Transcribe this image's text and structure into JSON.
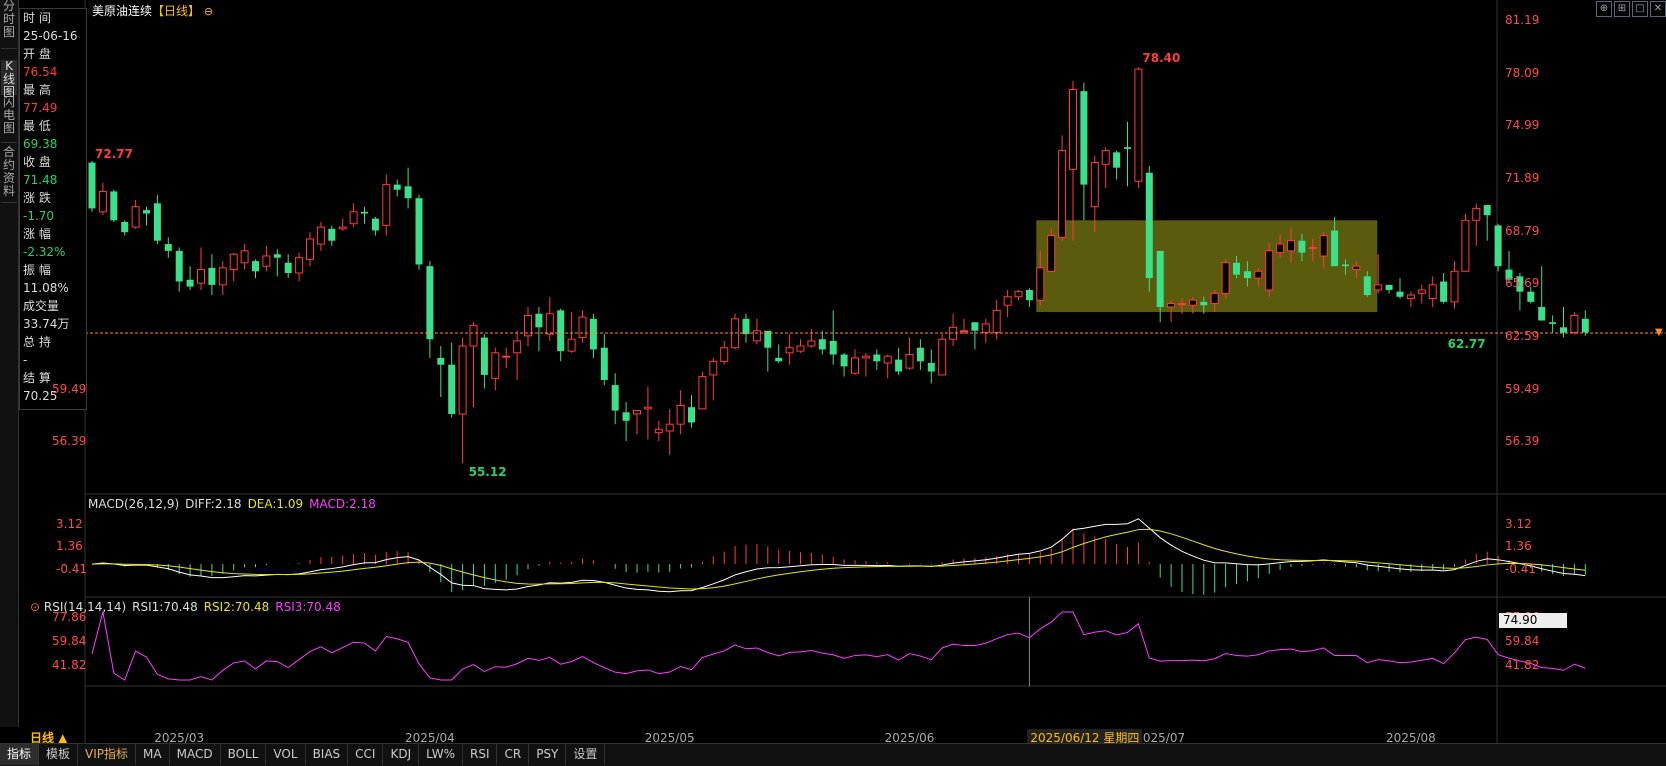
{
  "header": {
    "instrument": "美原油连续",
    "period": "【日线】",
    "settings_icon": "gear-icon"
  },
  "left_tabs": [
    {
      "label": "分时图",
      "active": false
    },
    {
      "label": "K线图",
      "active": true
    },
    {
      "label": "闪电图",
      "active": false
    },
    {
      "label": "合约资料",
      "active": false
    }
  ],
  "info": [
    {
      "label": "时 间",
      "value": "25-06-16",
      "color": "white"
    },
    {
      "label": "开 盘",
      "value": "76.54",
      "color": "red"
    },
    {
      "label": "最 高",
      "value": "77.49",
      "color": "red"
    },
    {
      "label": "最 低",
      "value": "69.38",
      "color": "green"
    },
    {
      "label": "收 盘",
      "value": "71.48",
      "color": "green"
    },
    {
      "label": "涨 跌",
      "value": "-1.70",
      "color": "green"
    },
    {
      "label": "涨 幅",
      "value": "-2.32%",
      "color": "green"
    },
    {
      "label": "振 幅",
      "value": "11.08%",
      "color": "white"
    },
    {
      "label": "成交量",
      "value": "33.74万",
      "color": "white"
    },
    {
      "label": "总 持",
      "value": "-",
      "color": "white"
    },
    {
      "label": "结 算",
      "value": "70.25",
      "color": "white"
    }
  ],
  "price_axis": {
    "labels": [
      "81.19",
      "78.09",
      "74.99",
      "71.89",
      "68.79",
      "65.69",
      "62.59",
      "59.49",
      "56.39"
    ],
    "min": 53.29,
    "max": 81.19,
    "current": "74.90"
  },
  "left_axis": [
    "59.49",
    "56.39"
  ],
  "annotations": {
    "high": "78.40",
    "low": "55.12",
    "start": "72.77",
    "last": "62.77"
  },
  "macd": {
    "title": "MACD(26,12,9)",
    "diff": "DIFF:2.18",
    "dea": "DEA:1.09",
    "macd": "MACD:2.18",
    "labels": [
      "3.12",
      "1.36",
      "-0.41"
    ]
  },
  "rsi": {
    "title": "RSI(14,14,14)",
    "rsi1": "RSI1:70.48",
    "rsi2": "RSI2:70.48",
    "rsi3": "RSI3:70.48",
    "labels": [
      "77.86",
      "59.84",
      "41.82"
    ]
  },
  "x_axis": {
    "labels": [
      "2025/03",
      "2025/04",
      "2025/05",
      "2025/06",
      "2025/07",
      "2025/08"
    ],
    "cursor_label": "2025/06/12 星期四",
    "period_label": "日线 ▲"
  },
  "bottom_tabs": [
    {
      "label": "指标",
      "active": true
    },
    {
      "label": "模板"
    },
    {
      "label": "VIP指标",
      "vip": true
    },
    {
      "label": "MA"
    },
    {
      "label": "MACD"
    },
    {
      "label": "BOLL"
    },
    {
      "label": "VOL"
    },
    {
      "label": "BIAS"
    },
    {
      "label": "CCI"
    },
    {
      "label": "KDJ"
    },
    {
      "label": "LW%"
    },
    {
      "label": "RSI"
    },
    {
      "label": "CR"
    },
    {
      "label": "PSY"
    },
    {
      "label": "设置"
    }
  ],
  "colors": {
    "up": "#ff3b3b",
    "down": "#3be08a",
    "axis": "#ff4a4a",
    "diff": "#ffffff",
    "dea": "#e6e600",
    "macd_text": "#ff3bff",
    "rsi": "#ff3bff",
    "highlight": "#6b6b10"
  },
  "chart_data": {
    "type": "candlestick",
    "title": "美原油连续",
    "candles": [
      [
        72.8,
        70.1,
        72.9,
        69.9
      ],
      [
        69.9,
        71.1,
        71.6,
        69.7
      ],
      [
        71.1,
        69.4,
        71.2,
        69.3
      ],
      [
        69.3,
        68.7,
        69.4,
        68.5
      ],
      [
        69.0,
        70.2,
        70.6,
        68.9
      ],
      [
        70.0,
        69.8,
        70.2,
        69.1
      ],
      [
        70.4,
        68.2,
        70.9,
        68.0
      ],
      [
        68.0,
        67.6,
        68.4,
        67.2
      ],
      [
        67.6,
        65.8,
        67.8,
        65.2
      ],
      [
        65.9,
        65.5,
        66.7,
        65.3
      ],
      [
        65.7,
        66.5,
        67.8,
        65.3
      ],
      [
        66.6,
        65.6,
        67.4,
        65.0
      ],
      [
        65.6,
        66.6,
        67.0,
        65.0
      ],
      [
        66.5,
        67.4,
        67.5,
        65.8
      ],
      [
        66.9,
        67.6,
        68.0,
        66.5
      ],
      [
        67.0,
        66.4,
        67.1,
        66.0
      ],
      [
        66.7,
        67.3,
        67.9,
        66.4
      ],
      [
        67.4,
        67.2,
        67.7,
        66.1
      ],
      [
        66.9,
        66.3,
        67.4,
        66.0
      ],
      [
        66.3,
        67.2,
        67.5,
        65.8
      ],
      [
        67.1,
        68.3,
        68.7,
        66.7
      ],
      [
        68.0,
        69.0,
        69.3,
        67.6
      ],
      [
        68.9,
        68.2,
        69.1,
        67.9
      ],
      [
        68.9,
        69.0,
        69.5,
        68.8
      ],
      [
        69.2,
        69.9,
        70.4,
        69.0
      ],
      [
        69.9,
        69.8,
        70.2,
        69.2
      ],
      [
        69.5,
        68.8,
        69.6,
        68.5
      ],
      [
        69.1,
        71.5,
        72.1,
        68.5
      ],
      [
        71.5,
        71.2,
        71.8,
        70.8
      ],
      [
        71.4,
        70.7,
        72.5,
        70.1
      ],
      [
        70.7,
        66.8,
        70.9,
        66.5
      ],
      [
        66.7,
        62.4,
        67.0,
        61.3
      ],
      [
        61.3,
        60.9,
        62.0,
        59.0
      ],
      [
        60.9,
        58.0,
        62.2,
        57.8
      ],
      [
        58.0,
        62.0,
        62.5,
        55.1
      ],
      [
        62.0,
        63.2,
        63.4,
        58.4
      ],
      [
        62.5,
        60.3,
        62.7,
        59.5
      ],
      [
        60.1,
        61.6,
        61.9,
        59.4
      ],
      [
        61.4,
        61.4,
        61.9,
        60.7
      ],
      [
        61.6,
        62.3,
        62.9,
        60.0
      ],
      [
        62.6,
        63.8,
        64.3,
        62.0
      ],
      [
        63.9,
        63.1,
        64.3,
        61.7
      ],
      [
        62.7,
        63.9,
        64.9,
        62.3
      ],
      [
        64.1,
        61.7,
        64.2,
        61.1
      ],
      [
        61.7,
        62.4,
        64.0,
        61.6
      ],
      [
        62.5,
        63.7,
        64.1,
        62.2
      ],
      [
        63.6,
        61.8,
        63.9,
        61.3
      ],
      [
        61.9,
        60.0,
        62.7,
        59.7
      ],
      [
        59.7,
        58.2,
        60.4,
        57.4
      ],
      [
        58.1,
        57.6,
        58.7,
        56.4
      ],
      [
        58.0,
        58.2,
        58.2,
        56.8
      ],
      [
        58.3,
        58.4,
        59.6,
        56.5
      ],
      [
        56.9,
        57.1,
        57.6,
        56.4
      ],
      [
        57.0,
        57.4,
        58.3,
        55.6
      ],
      [
        57.4,
        58.5,
        59.4,
        56.8
      ],
      [
        58.4,
        57.5,
        59.1,
        57.2
      ],
      [
        58.3,
        60.2,
        60.5,
        58.6
      ],
      [
        60.3,
        61.1,
        61.3,
        58.8
      ],
      [
        61.1,
        61.9,
        62.3,
        60.9
      ],
      [
        61.9,
        63.6,
        63.9,
        61.8
      ],
      [
        63.6,
        62.7,
        63.9,
        62.2
      ],
      [
        62.3,
        62.9,
        63.6,
        62.1
      ],
      [
        62.9,
        61.9,
        62.6,
        60.5
      ],
      [
        61.3,
        61.1,
        62.1,
        61.0
      ],
      [
        61.6,
        61.9,
        62.7,
        60.9
      ],
      [
        61.7,
        62.0,
        62.4,
        61.6
      ],
      [
        62.0,
        62.3,
        63.0,
        61.9
      ],
      [
        62.4,
        61.8,
        62.9,
        61.5
      ],
      [
        62.3,
        61.5,
        64.1,
        60.9
      ],
      [
        61.5,
        60.8,
        61.6,
        60.2
      ],
      [
        60.4,
        61.3,
        61.8,
        60.3
      ],
      [
        61.3,
        61.4,
        61.6,
        60.2
      ],
      [
        61.5,
        61.1,
        61.8,
        60.6
      ],
      [
        61.0,
        61.4,
        61.5,
        60.1
      ],
      [
        61.2,
        60.5,
        61.9,
        60.3
      ],
      [
        60.7,
        61.5,
        62.5,
        60.6
      ],
      [
        61.9,
        61.1,
        62.4,
        60.6
      ],
      [
        61.0,
        60.5,
        61.8,
        59.8
      ],
      [
        60.3,
        62.4,
        62.7,
        60.3
      ],
      [
        62.4,
        63.1,
        63.9,
        62.0
      ],
      [
        62.9,
        62.9,
        63.6,
        62.7
      ],
      [
        63.4,
        62.9,
        63.4,
        61.8
      ],
      [
        62.8,
        63.3,
        63.6,
        62.2
      ],
      [
        62.8,
        64.1,
        64.7,
        62.4
      ],
      [
        64.4,
        64.9,
        65.3,
        63.7
      ],
      [
        64.9,
        65.2,
        65.3,
        64.7
      ],
      [
        65.3,
        64.7,
        65.4,
        64.3
      ],
      [
        64.7,
        66.6,
        67.6,
        64.4
      ],
      [
        66.4,
        68.5,
        68.9,
        66.5
      ],
      [
        68.4,
        73.5,
        74.4,
        68.2
      ],
      [
        72.4,
        77.1,
        77.6,
        68.2
      ],
      [
        77.0,
        71.5,
        77.5,
        69.4
      ],
      [
        70.2,
        72.8,
        73.2,
        68.7
      ],
      [
        72.7,
        73.5,
        73.7,
        71.3
      ],
      [
        73.4,
        72.5,
        73.5,
        71.8
      ],
      [
        73.7,
        73.6,
        75.2,
        71.4
      ],
      [
        71.7,
        78.3,
        78.4,
        71.3
      ],
      [
        72.2,
        66.0,
        72.6,
        65.2
      ],
      [
        67.6,
        64.3,
        67.4,
        63.4
      ],
      [
        64.3,
        64.5,
        64.7,
        63.4
      ],
      [
        64.5,
        64.5,
        64.8,
        63.9
      ],
      [
        64.4,
        64.7,
        64.9,
        63.9
      ],
      [
        64.6,
        64.4,
        64.9,
        63.9
      ],
      [
        64.5,
        65.1,
        65.3,
        64.0
      ],
      [
        65.1,
        66.9,
        67.1,
        64.8
      ],
      [
        66.9,
        66.2,
        67.3,
        66.0
      ],
      [
        66.4,
        66.0,
        67.0,
        65.5
      ],
      [
        66.0,
        66.4,
        66.6,
        65.5
      ],
      [
        65.3,
        67.6,
        68.1,
        64.9
      ],
      [
        67.5,
        68.0,
        68.6,
        67.2
      ],
      [
        67.6,
        68.2,
        69.0,
        66.9
      ],
      [
        68.2,
        67.5,
        68.6,
        67.0
      ],
      [
        67.8,
        67.8,
        68.3,
        67.0
      ],
      [
        67.3,
        68.5,
        68.7,
        66.6
      ],
      [
        68.8,
        66.7,
        69.6,
        66.7
      ],
      [
        66.8,
        66.7,
        67.1,
        66.2
      ],
      [
        66.5,
        66.7,
        67.0,
        66.0
      ],
      [
        66.1,
        65.0,
        66.4,
        64.9
      ],
      [
        65.3,
        65.6,
        67.4,
        65.1
      ],
      [
        65.6,
        65.3,
        65.6,
        65.1
      ],
      [
        65.2,
        64.9,
        66.0,
        64.8
      ],
      [
        64.8,
        65.0,
        65.2,
        64.3
      ],
      [
        65.1,
        65.3,
        65.6,
        64.5
      ],
      [
        64.8,
        65.6,
        66.1,
        64.3
      ],
      [
        65.8,
        64.6,
        66.3,
        64.5
      ],
      [
        64.6,
        66.4,
        67.0,
        64.2
      ],
      [
        66.4,
        69.4,
        69.8,
        66.5
      ],
      [
        69.4,
        70.1,
        70.4,
        67.9
      ],
      [
        70.3,
        69.7,
        70.3,
        68.2
      ],
      [
        69.1,
        66.7,
        69.2,
        66.4
      ],
      [
        66.5,
        65.9,
        67.6,
        65.7
      ],
      [
        66.1,
        65.2,
        66.3,
        64.1
      ],
      [
        65.2,
        64.6,
        65.5,
        64.5
      ],
      [
        64.3,
        63.5,
        66.7,
        63.5
      ],
      [
        63.4,
        63.3,
        63.8,
        62.8
      ],
      [
        63.1,
        62.8,
        64.3,
        62.5
      ],
      [
        62.8,
        63.8,
        64.0,
        62.7
      ],
      [
        63.6,
        62.8,
        64.1,
        62.6
      ]
    ]
  }
}
